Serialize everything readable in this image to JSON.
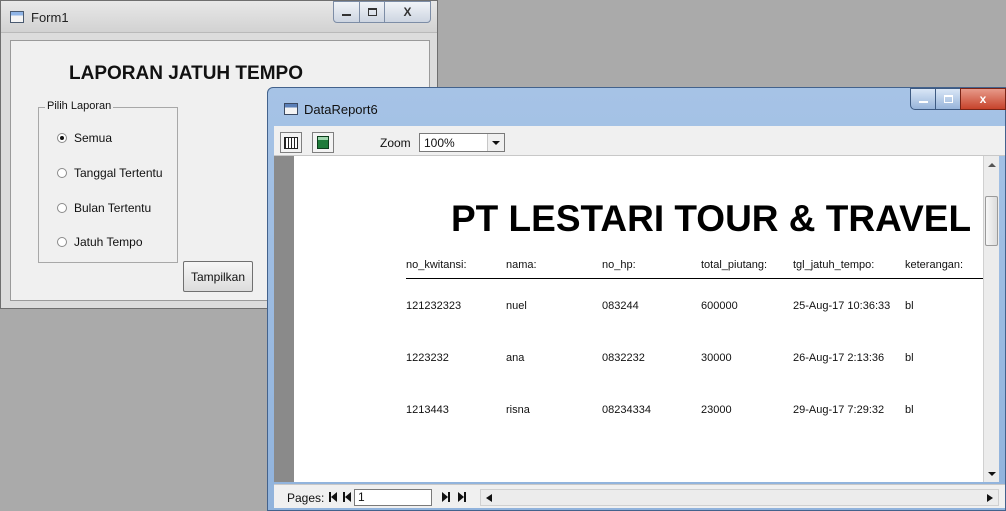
{
  "form1": {
    "title": "Form1",
    "heading": "LAPORAN JATUH TEMPO",
    "group_label": "Pilih Laporan",
    "options": [
      {
        "label": "Semua",
        "selected": true
      },
      {
        "label": "Tanggal Tertentu",
        "selected": false
      },
      {
        "label": "Bulan Tertentu",
        "selected": false
      },
      {
        "label": "Jatuh Tempo",
        "selected": false
      }
    ],
    "show_button": "Tampilkan"
  },
  "report": {
    "title": "DataReport6",
    "zoom_label": "Zoom",
    "zoom_value": "100%",
    "company": "PT LESTARI TOUR & TRAVEL",
    "columns": [
      "no_kwitansi:",
      "nama:",
      "no_hp:",
      "total_piutang:",
      "tgl_jatuh_tempo:",
      "keterangan:"
    ],
    "rows": [
      [
        "121232323",
        "nuel",
        "083244",
        "600000",
        "25-Aug-17 10:36:33",
        "bl"
      ],
      [
        "1223232",
        "ana",
        "0832232",
        "30000",
        "26-Aug-17 2:13:36",
        "bl"
      ],
      [
        "1213443",
        "risna",
        "08234334",
        "23000",
        "29-Aug-17 7:29:32",
        "bl"
      ]
    ],
    "pages_label": "Pages:",
    "page_value": "1"
  },
  "icons": {
    "minimize": "minimize-icon",
    "maximize": "maximize-icon",
    "close": "close-icon",
    "print": "print-icon",
    "export": "export-icon"
  }
}
